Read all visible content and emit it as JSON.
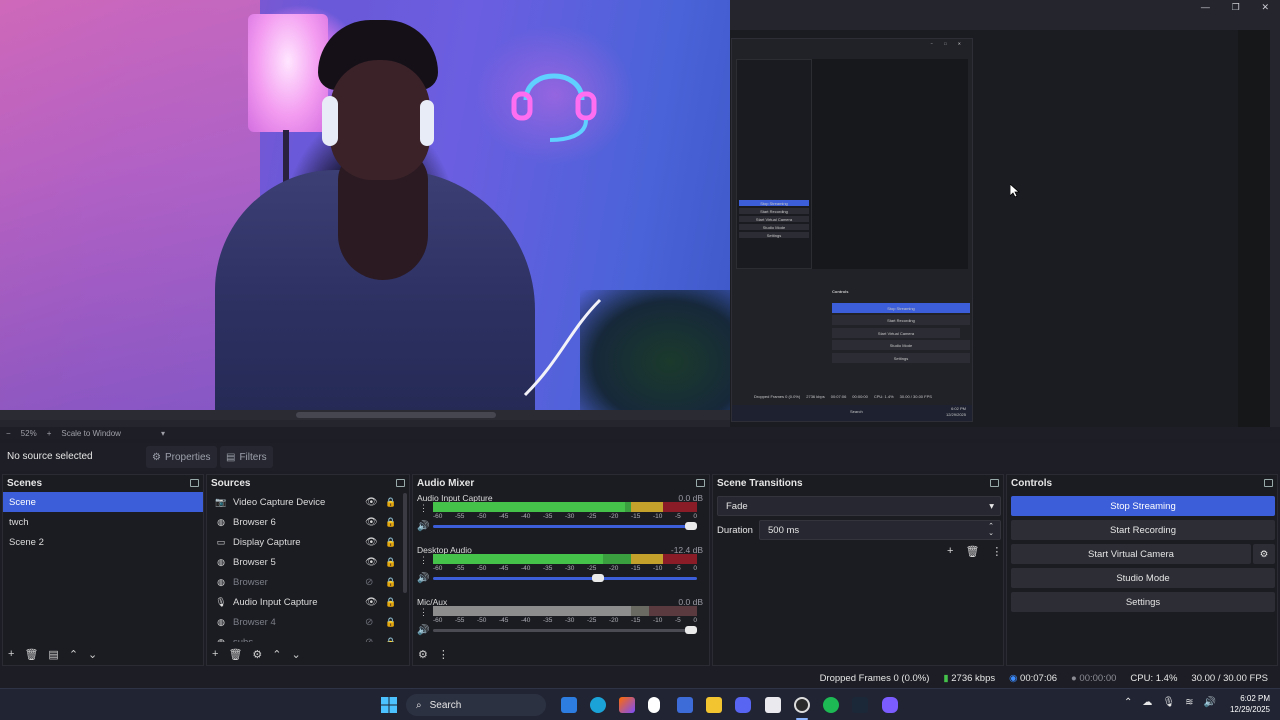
{
  "window": {
    "minimize": "—",
    "restore": "❐",
    "close": "✕"
  },
  "preview": {
    "zoom": "52%",
    "scale_mode": "Scale to Window",
    "minus": "−",
    "plus": "+"
  },
  "nested": {
    "controls_title": "Controls",
    "buttons": [
      "Stop Streaming",
      "Start Recording",
      "Start Virtual Camera",
      "Studio Mode",
      "Settings"
    ],
    "dropped": "Dropped Frames 0 (0.0%)",
    "kbps": "2736 kbps",
    "time": "00:07:06",
    "rec": "00:00:00",
    "cpu": "CPU: 1.4%",
    "fps": "30.00 / 30.00 FPS",
    "search": "Search",
    "clock_time": "6:02 PM",
    "clock_date": "12/29/2025",
    "mini_items": [
      "Stop Streaming",
      "Start Recording",
      "Start Virtual Camera",
      "Studio Mode",
      "Settings"
    ]
  },
  "source_bar": {
    "no_source": "No source selected",
    "properties": "Properties",
    "filters": "Filters"
  },
  "scenes": {
    "title": "Scenes",
    "items": [
      "Scene",
      "twch",
      "Scene 2"
    ],
    "selected": 0
  },
  "sources": {
    "title": "Sources",
    "items": [
      {
        "name": "Video Capture Device",
        "icon": "camera-icon",
        "visible": true
      },
      {
        "name": "Browser 6",
        "icon": "globe-icon",
        "visible": true
      },
      {
        "name": "Display Capture",
        "icon": "monitor-icon",
        "visible": true
      },
      {
        "name": "Browser 5",
        "icon": "globe-icon",
        "visible": true
      },
      {
        "name": "Browser",
        "icon": "globe-icon",
        "visible": false
      },
      {
        "name": "Audio Input Capture",
        "icon": "microphone-icon",
        "visible": true
      },
      {
        "name": "Browser 4",
        "icon": "globe-icon",
        "visible": false
      },
      {
        "name": "subs",
        "icon": "globe-icon",
        "visible": false
      }
    ]
  },
  "mixer": {
    "title": "Audio Mixer",
    "channels": [
      {
        "name": "Audio Input Capture",
        "db": "0.0 dB",
        "level": 0.52,
        "fader": 1.0
      },
      {
        "name": "Desktop Audio",
        "db": "-12.4 dB",
        "level": 0.46,
        "fader": 0.63
      },
      {
        "name": "Mic/Aux",
        "db": "0.0 dB",
        "level": 0.0,
        "fader": 1.0
      }
    ],
    "scale": [
      "-60",
      "-55",
      "-50",
      "-45",
      "-40",
      "-35",
      "-30",
      "-25",
      "-20",
      "-15",
      "-10",
      "-5",
      "0"
    ]
  },
  "transitions": {
    "title": "Scene Transitions",
    "selected": "Fade",
    "duration_label": "Duration",
    "duration_value": "500 ms"
  },
  "controls": {
    "title": "Controls",
    "stop_streaming": "Stop Streaming",
    "start_recording": "Start Recording",
    "start_virtual_camera": "Start Virtual Camera",
    "studio_mode": "Studio Mode",
    "settings": "Settings"
  },
  "status": {
    "dropped": "Dropped Frames 0 (0.0%)",
    "kbps": "2736 kbps",
    "stream_time": "00:07:06",
    "rec_time": "00:00:00",
    "cpu": "CPU: 1.4%",
    "fps": "30.00 / 30.00 FPS"
  },
  "taskbar": {
    "search": "Search",
    "time": "6:02 PM",
    "date": "12/29/2025"
  },
  "colors": {
    "accent": "#3c5ed8",
    "meter_green": "#45c24a",
    "meter_yellow": "#c4a12a",
    "meter_red": "#8a1c28"
  }
}
